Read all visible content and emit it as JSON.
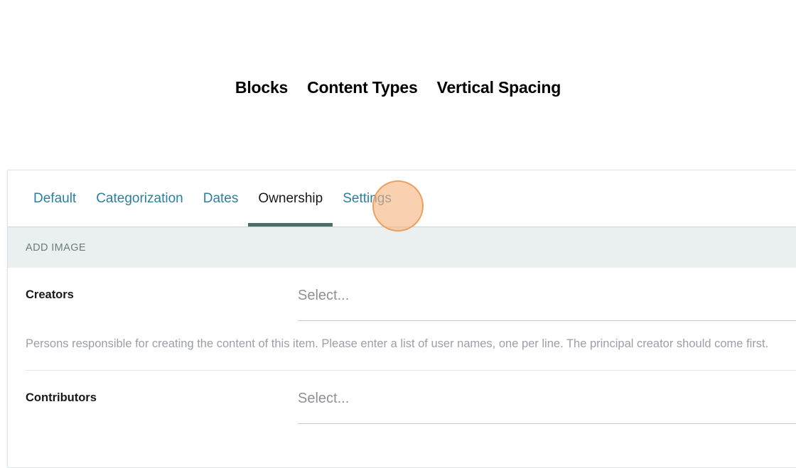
{
  "headings": [
    {
      "label": "Blocks"
    },
    {
      "label": "Content Types"
    },
    {
      "label": "Vertical Spacing"
    }
  ],
  "panel": {
    "tabs": [
      {
        "label": "Default",
        "active": false
      },
      {
        "label": "Categorization",
        "active": false
      },
      {
        "label": "Dates",
        "active": false
      },
      {
        "label": "Ownership",
        "active": true
      },
      {
        "label": "Settings",
        "active": false
      }
    ],
    "section": {
      "label": "ADD IMAGE"
    },
    "fields": [
      {
        "label": "Creators",
        "placeholder": "Select...",
        "help": "Persons responsible for creating the content of this item. Please enter a list of user names, one per line. The principal creator should come first."
      },
      {
        "label": "Contributors",
        "placeholder": "Select..."
      }
    ]
  },
  "cursor": {
    "target_label": "Settings",
    "fill_color": "#f7b480",
    "border_color": "#ed9148"
  },
  "colors": {
    "tab_link": "#2b7fa0",
    "tab_active_text": "#16181a",
    "tab_active_underline": "#4c6d6d",
    "section_band_bg": "#eaf0f0",
    "section_band_text": "#6b7c80",
    "placeholder_text": "#8b9196",
    "help_text": "#9aa0a6",
    "panel_border": "#dfe3e6",
    "page_bg": "#ffffff"
  }
}
